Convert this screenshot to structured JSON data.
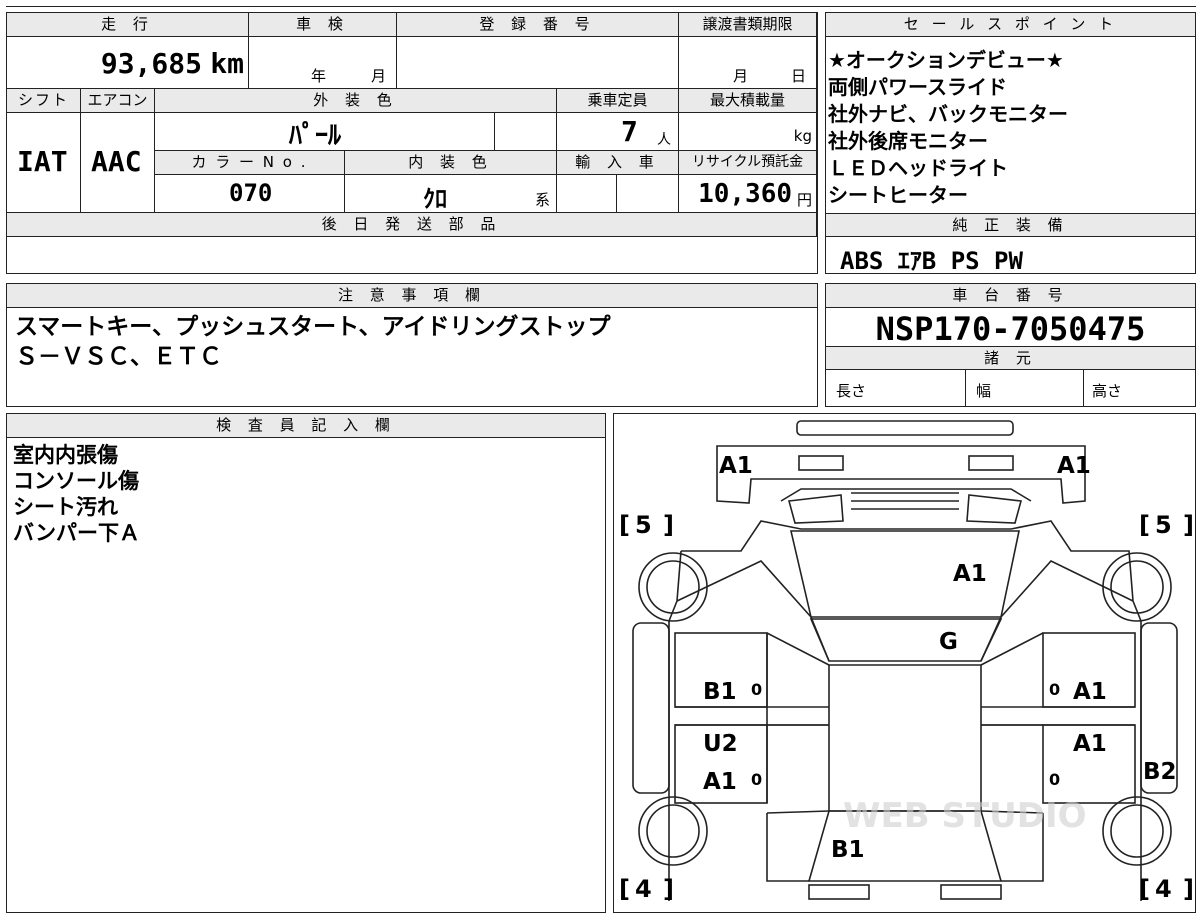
{
  "top": {
    "mileage_label": "走 行",
    "mileage_value": "93,685",
    "mileage_unit": "km",
    "inspection_label": "車 検",
    "inspection_year_unit": "年",
    "inspection_month_unit": "月",
    "registration_label": "登 録 番 号",
    "transfer_label": "譲渡書類期限",
    "transfer_month_unit": "月",
    "transfer_day_unit": "日",
    "shift_label": "シフト",
    "shift_value": "IAT",
    "ac_label": "エアコン",
    "ac_value": "AAC",
    "exterior_label": "外 装 色",
    "exterior_value": "ﾊﾟｰﾙ",
    "capacity_label": "乗車定員",
    "capacity_value": "7",
    "capacity_unit": "人",
    "maxload_label": "最大積載量",
    "maxload_unit": "kg",
    "color_no_label": "カ ラ ー N o .",
    "color_no_value": "070",
    "interior_label": "内 装 色",
    "interior_value": "ｸﾛ",
    "interior_suffix": "系",
    "import_label": "輸 入 車",
    "recycle_label": "リサイクル預託金",
    "recycle_value": "10,360",
    "recycle_unit": "円",
    "later_parts_label": "後 日 発 送 部 品"
  },
  "sales": {
    "label": "セ ー ル ス ポ イ ン ト",
    "points": [
      "★オークションデビュー★",
      "両側パワースライド",
      "社外ナビ、バックモニター",
      "社外後席モニター",
      "ＬＥＤヘッドライト",
      "シートヒーター"
    ]
  },
  "equipment": {
    "label": "純 正 装 備",
    "value": "ABS ｴｱB PS PW"
  },
  "notes": {
    "label": "注 意 事 項 欄",
    "lines": [
      "スマートキー、プッシュスタート、アイドリングストップ",
      "Ｓ－ＶＳＣ、ＥＴＣ"
    ]
  },
  "chassis": {
    "label": "車 台 番 号",
    "value": "NSP170-7050475",
    "specs_label": "諸 元",
    "length_label": "長さ",
    "width_label": "幅",
    "height_label": "高さ"
  },
  "inspector": {
    "label": "検 査 員 記 入 欄",
    "lines": [
      "室内内張傷",
      "コンソール傷",
      "シート汚れ",
      "バンパー下Ａ"
    ]
  },
  "diagram": {
    "marks": {
      "front_left": "A1",
      "front_right": "A1",
      "hood": "A1",
      "windshield": "G",
      "left_front_door": "B1",
      "right_front_door": "A1",
      "left_rear_door_a": "U2",
      "left_rear_door_b": "A1",
      "right_rear_door": "A1",
      "right_quarter": "B2",
      "roof_rear": "B1"
    },
    "tire_front_left": "5",
    "tire_front_right": "5",
    "tire_rear_left": "4",
    "tire_rear_right": "4",
    "door_zero_1": "0",
    "door_zero_2": "0",
    "door_zero_3": "0",
    "door_zero_4": "0",
    "watermark": "WEB STUDIO"
  }
}
